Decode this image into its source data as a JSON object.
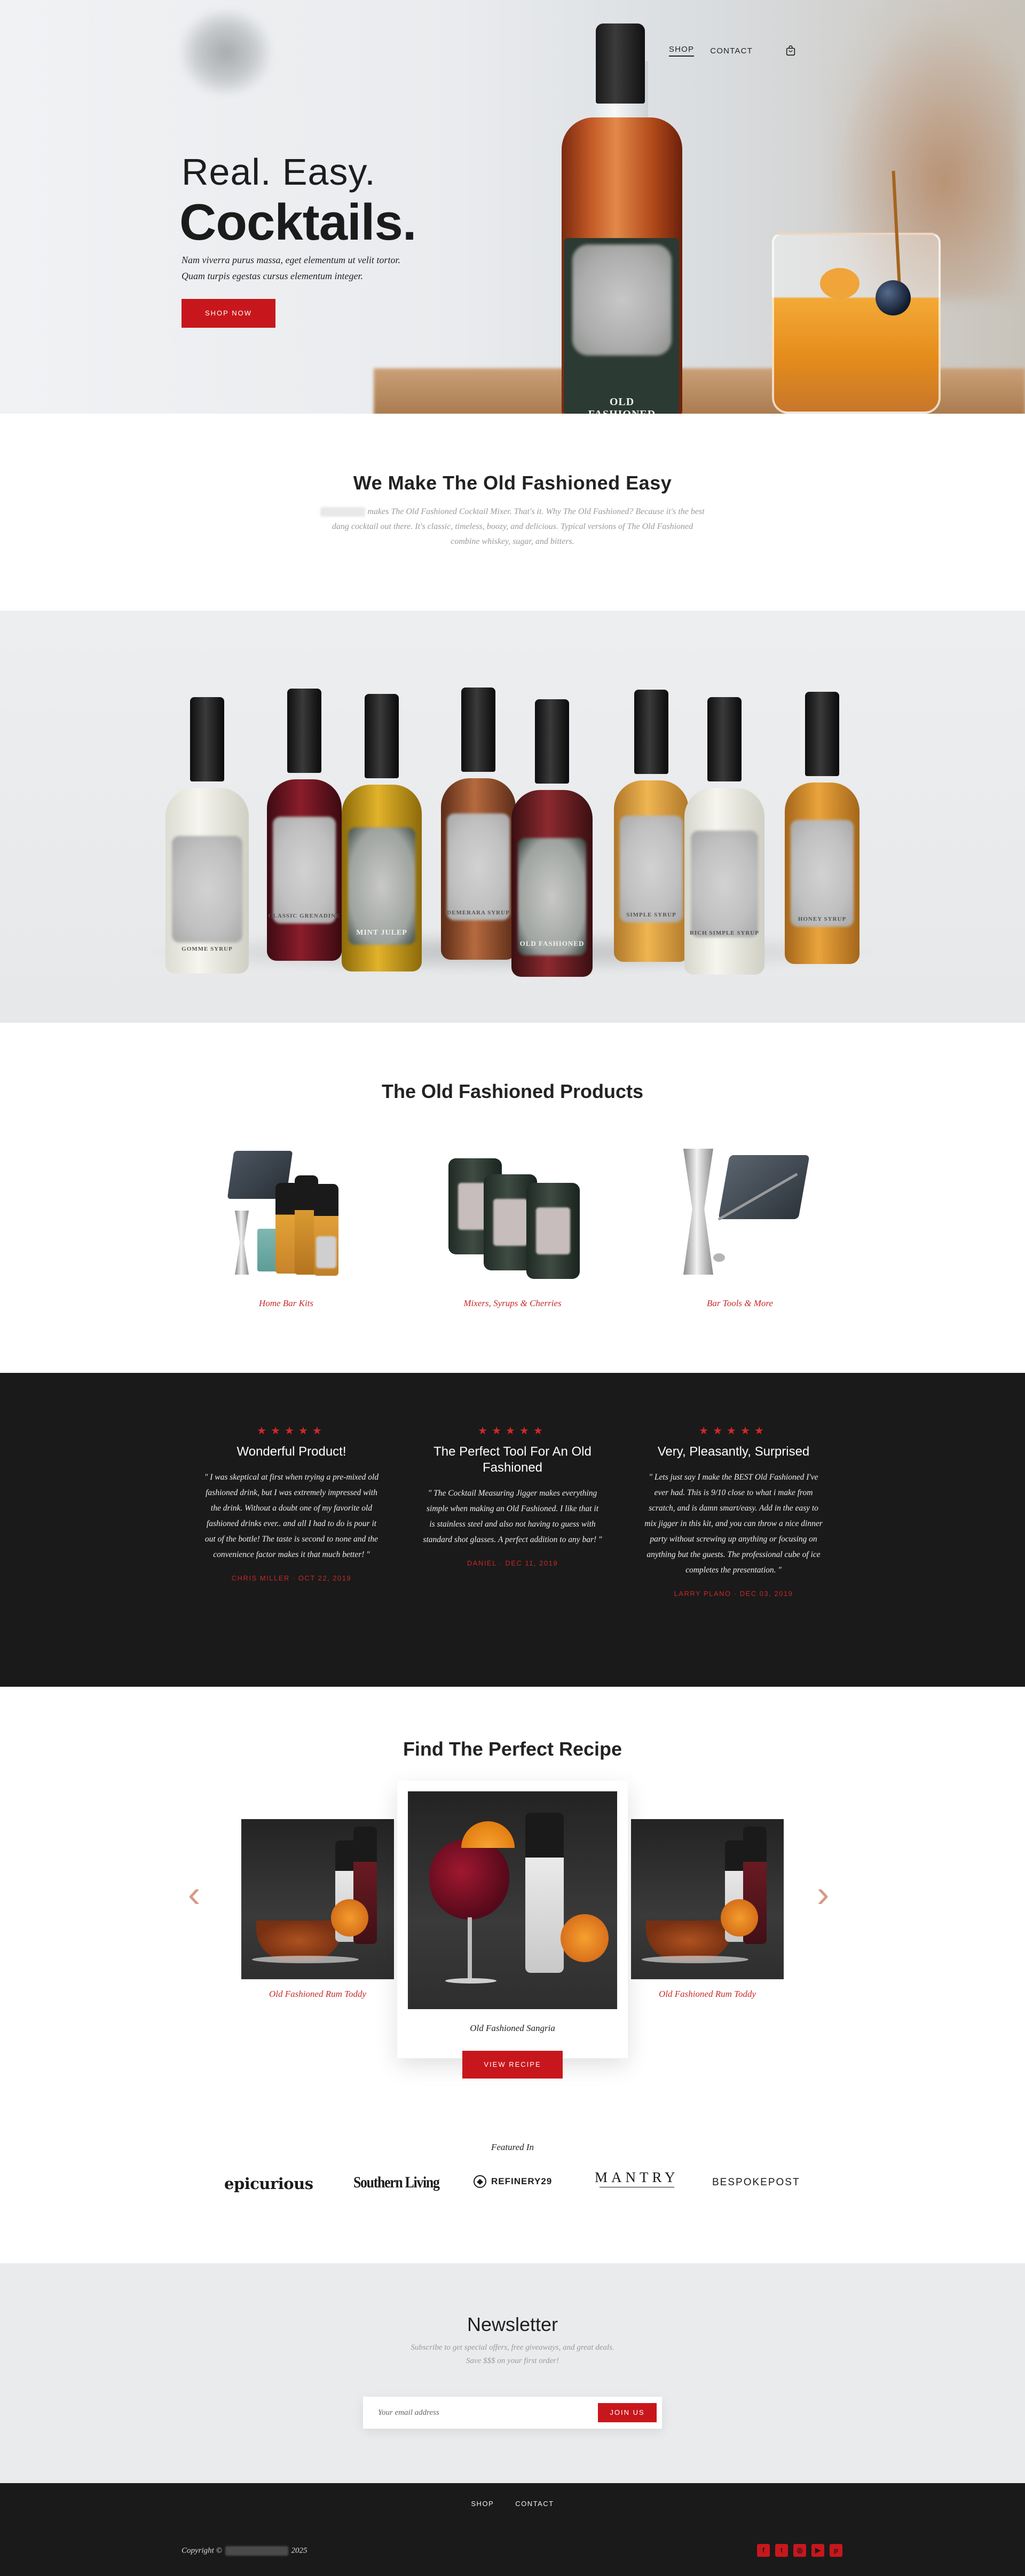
{
  "nav": {
    "items": [
      "SHOP",
      "CONTACT"
    ],
    "cart_icon": "shopping-bag-icon"
  },
  "hero": {
    "title_light": "Real. Easy.",
    "title_bold": "Cocktails.",
    "subtitle_line1": "Nam viverra purus massa, eget elementum ut velit tortor.",
    "subtitle_line2": "Quam turpis egestas cursus elementum integer.",
    "cta": "SHOP NOW",
    "bottle_label": "OLD FASHIONED"
  },
  "intro": {
    "title": "We Make The Old Fashioned Easy",
    "text_line1": "makes The Old Fashioned Cocktail Mixer. That's it. Why The Old Fashioned? Because it's the best",
    "text_line2": "dang cocktail out there. It's classic, timeless, boozy, and delicious. Typical versions of The Old Fashioned",
    "text_line3": "combine whiskey, sugar, and bitters."
  },
  "showcase": {
    "labels": [
      "GOMME SYRUP",
      "CLASSIC GRENADINE",
      "MINT JULEP",
      "DEMERARA SYRUP",
      "OLD FASHIONED",
      "SIMPLE SYRUP",
      "RICH SIMPLE SYRUP",
      "HONEY SYRUP"
    ]
  },
  "products": {
    "title": "The Old Fashioned Products",
    "items": [
      {
        "label": "Home Bar Kits"
      },
      {
        "label": "Mixers, Syrups & Cherries"
      },
      {
        "label": "Bar Tools & More"
      }
    ]
  },
  "testimonials": [
    {
      "stars": "★★★★★",
      "title": "Wonderful Product!",
      "quote": "\" I was skeptical at first when trying a pre-mixed old fashioned drink, but I was extremely impressed with the drink. Without a doubt one of my favorite old fashioned drinks ever.. and all I had to do is pour it out of the bottle! The taste is second to none and the convenience factor makes it that much better! \"",
      "author": "CHRIS MILLER · OCT 22, 2019"
    },
    {
      "stars": "★★★★★",
      "title": "The Perfect Tool For An Old Fashioned",
      "quote": "\" The Cocktail Measuring Jigger makes everything simple when making an Old Fashioned. I like that it is stainless steel and also not having to guess with standard shot glasses. A perfect addition to any bar! \"",
      "author": "DANIEL · DEC 11, 2019"
    },
    {
      "stars": "★★★★★",
      "title": "Very, Pleasantly, Surprised",
      "quote": "\" Lets just say I make the BEST Old Fashioned I've ever had. This is 9/10 close to what i make from scratch, and is damn smart/easy. Add in the easy to mix jigger in this kit, and you can throw a nice dinner party without screwing up anything or focusing on anything but the guests. The professional cube of ice completes the presentation. \"",
      "author": "LARRY PLANO · DEC 03, 2019"
    }
  ],
  "recipes": {
    "title": "Find The Perfect Recipe",
    "cards": [
      "Old Fashioned Rum Toddy",
      "Old Fashioned Sangria",
      "Old Fashioned Rum Toddy"
    ],
    "cta": "VIEW RECIPE",
    "prev_icon": "chevron-left-icon",
    "next_icon": "chevron-right-icon"
  },
  "featured": {
    "title": "Featured In",
    "logos": [
      "epicurious",
      "Southern Living",
      "REFINERY29",
      "MANTRY",
      "BESPOKEPOST"
    ]
  },
  "newsletter": {
    "title": "Newsletter",
    "sub_line1": "Subscribe to get special offers, free giveaways, and great deals.",
    "sub_line2": "Save $$$ on your first order!",
    "placeholder": "Your email address",
    "button": "JOIN US"
  },
  "footer": {
    "links": [
      "SHOP",
      "CONTACT"
    ],
    "copyright_prefix": "Copyright ©",
    "copyright_year": "2025",
    "social_icons": [
      "facebook-icon",
      "twitter-icon",
      "instagram-icon",
      "youtube-icon",
      "pinterest-icon"
    ]
  },
  "colors": {
    "accent": "#c8171c",
    "dark": "#1a1a1a",
    "light_bg": "#eaebed"
  }
}
